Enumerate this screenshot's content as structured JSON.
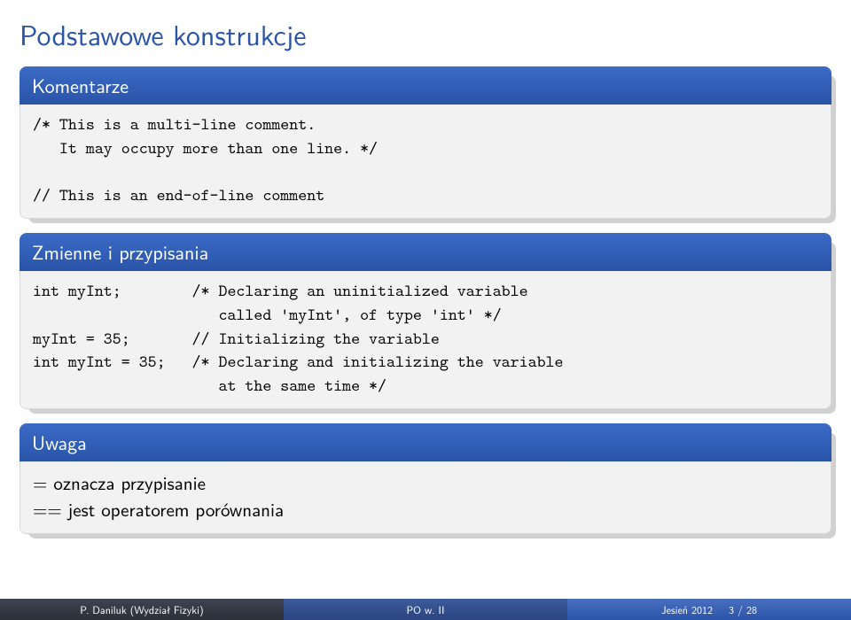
{
  "title": "Podstawowe konstrukcje",
  "blocks": {
    "comments": {
      "header": "Komentarze",
      "body": "/* This is a multi-line comment.\n   It may occupy more than one line. */\n\n// This is an end-of-line comment"
    },
    "vars": {
      "header": "Zmienne i przypisania",
      "body": "int myInt;        /* Declaring an uninitialized variable\n                     called 'myInt', of type 'int' */\nmyInt = 35;       // Initializing the variable\nint myInt = 35;   /* Declaring and initializing the variable\n                     at the same time */"
    },
    "note": {
      "header": "Uwaga",
      "line1": "= oznacza przypisanie",
      "line2": "== jest operatorem porównania"
    }
  },
  "footer": {
    "left": "P. Daniluk (Wydział Fizyki)",
    "mid": "PO w. II",
    "right_term": "Jesień 2012",
    "right_page": "3 / 28"
  }
}
